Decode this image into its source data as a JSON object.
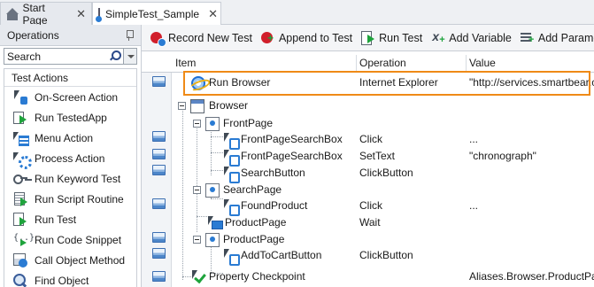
{
  "tabs": [
    {
      "label": "Start Page",
      "icon": "home-icon",
      "close": "✕"
    },
    {
      "label": "SimpleTest_Sample",
      "icon": "keyword-test-icon",
      "close": "✕"
    }
  ],
  "sidebar": {
    "title": "Operations",
    "search_value": "Search",
    "group": "Test Actions",
    "items": [
      {
        "label": "On-Screen Action",
        "icon": "on-screen-action-icon"
      },
      {
        "label": "Run TestedApp",
        "icon": "run-testedapp-icon"
      },
      {
        "label": "Menu Action",
        "icon": "menu-action-icon"
      },
      {
        "label": "Process Action",
        "icon": "process-action-icon"
      },
      {
        "label": "Run Keyword Test",
        "icon": "run-keyword-test-icon"
      },
      {
        "label": "Run Script Routine",
        "icon": "run-script-routine-icon"
      },
      {
        "label": "Run Test",
        "icon": "run-test-icon"
      },
      {
        "label": "Run Code Snippet",
        "icon": "run-code-snippet-icon"
      },
      {
        "label": "Call Object Method",
        "icon": "call-object-method-icon"
      },
      {
        "label": "Find Object",
        "icon": "find-object-icon"
      }
    ]
  },
  "toolbar": {
    "record": "Record New Test",
    "append": "Append to Test",
    "run": "Run Test",
    "add_variable": "Add Variable",
    "add_parameter": "Add Parameter"
  },
  "grid": {
    "columns": {
      "item": "Item",
      "operation": "Operation",
      "value": "Value"
    },
    "rows": [
      {
        "item": "Run Browser",
        "operation": "Internet Explorer",
        "value": "\"http://services.smartbear.c",
        "icon": "ie-icon",
        "has_screenshot": true
      },
      {
        "item": "Browser",
        "operation": "",
        "value": "",
        "icon": "browser-icon",
        "has_screenshot": false
      },
      {
        "item": "FrontPage",
        "operation": "",
        "value": "",
        "icon": "page-icon",
        "has_screenshot": true
      },
      {
        "item": "FrontPageSearchBox",
        "operation": "Click",
        "value": "...",
        "icon": "on-screen-action-icon",
        "has_screenshot": true
      },
      {
        "item": "FrontPageSearchBox",
        "operation": "SetText",
        "value": "\"chronograph\"",
        "icon": "on-screen-action-icon",
        "has_screenshot": true
      },
      {
        "item": "SearchButton",
        "operation": "ClickButton",
        "value": "",
        "icon": "on-screen-action-icon",
        "has_screenshot": false
      },
      {
        "item": "SearchPage",
        "operation": "",
        "value": "",
        "icon": "page-icon",
        "has_screenshot": true
      },
      {
        "item": "FoundProduct",
        "operation": "Click",
        "value": "...",
        "icon": "on-screen-action-icon",
        "has_screenshot": false
      },
      {
        "item": "ProductPage",
        "operation": "Wait",
        "value": "",
        "icon": "monitor-icon",
        "has_screenshot": true
      },
      {
        "item": "ProductPage",
        "operation": "",
        "value": "",
        "icon": "page-icon",
        "has_screenshot": true
      },
      {
        "item": "AddToCartButton",
        "operation": "ClickButton",
        "value": "",
        "icon": "on-screen-action-icon",
        "has_screenshot": false
      },
      {
        "item": "Property Checkpoint",
        "operation": "",
        "value": "Aliases.Browser.ProductPag",
        "icon": "checkpoint-icon",
        "has_screenshot": true
      }
    ]
  },
  "colors": {
    "highlight": "#ef8a17",
    "record": "#d11f2b",
    "play": "#1ea33c",
    "accent": "#2a7bd3"
  }
}
